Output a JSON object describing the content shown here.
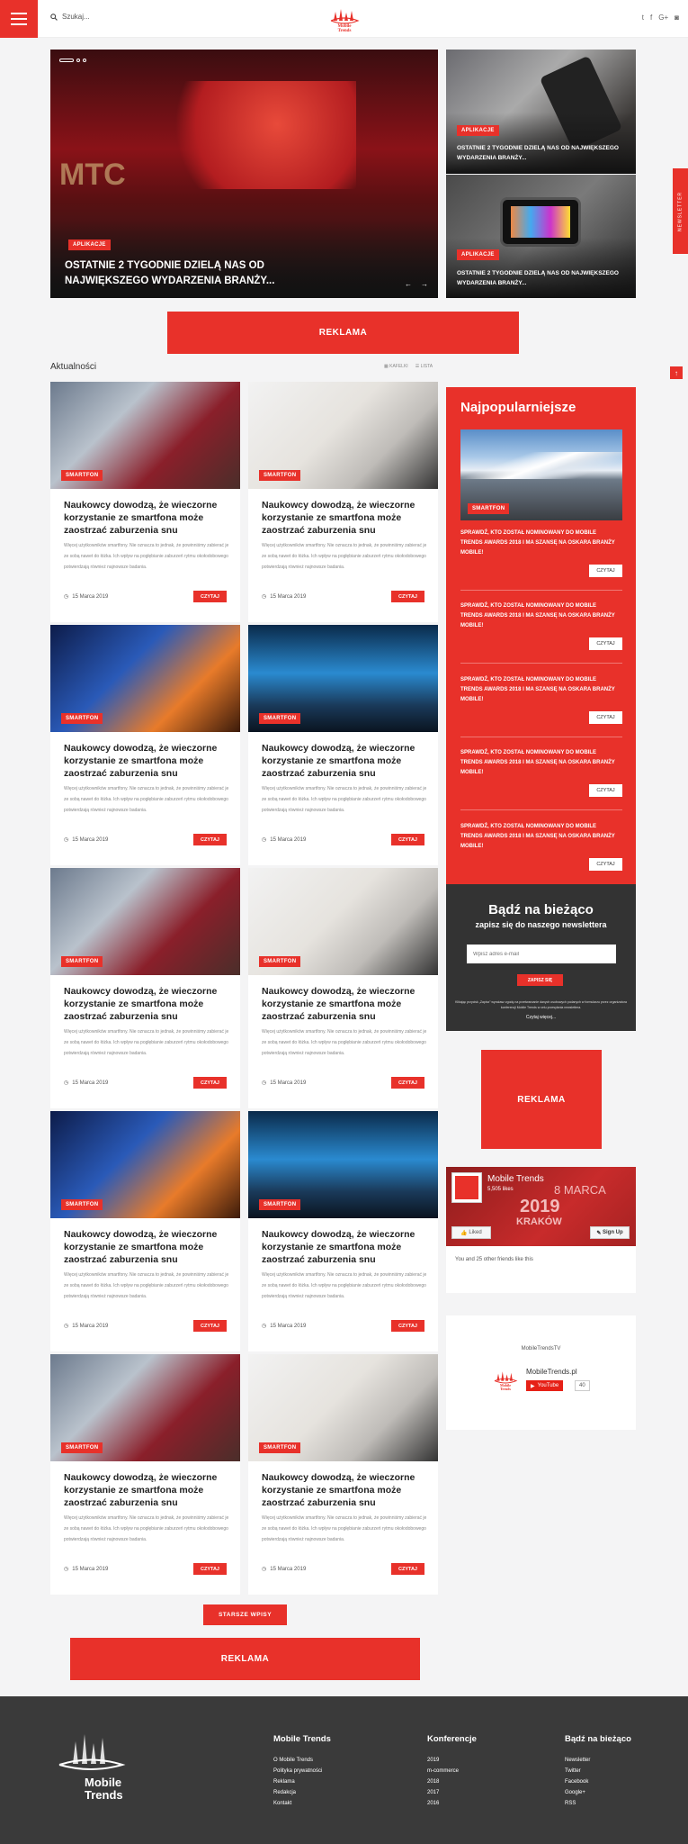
{
  "header": {
    "search_label": "Szukaj..."
  },
  "hero": {
    "main": {
      "tag": "APLIKACJE",
      "title": "OSTATNIE 2 TYGODNIE DZIELĄ NAS OD NAJWIĘKSZEGO WYDARZENIA BRANŻY...",
      "prev": "←",
      "next": "→"
    },
    "side1": {
      "tag": "APLIKACJE",
      "title": "OSTATNIE 2 TYGODNIE DZIELĄ NAS OD NAJWIĘKSZEGO WYDARZENIA BRANŻY..."
    },
    "side2": {
      "tag": "APLIKACJE",
      "title": "OSTATNIE 2 TYGODNIE DZIELĄ NAS OD NAJWIĘKSZEGO WYDARZENIA BRANŻY..."
    }
  },
  "ads": {
    "top": "REKLAMA",
    "side": "REKLAMA",
    "bottom": "REKLAMA"
  },
  "news_section": {
    "title": "Aktualności",
    "view_tiles": "KAFELKI",
    "view_list": "LISTA",
    "older_button": "STARSZE WPISY"
  },
  "cards": [
    {
      "tag": "SMARTFON",
      "title": "Naukowcy dowodzą, że wieczorne korzystanie ze smartfona może zaostrzać zaburzenia snu",
      "text": "Więcej użytkowników smartfony. Nie oznacza to jednak, że powinniśmy zabierać je ze sobą nawet do łóżka. Ich wpływ na pogłębianie zaburzeń rytmu okołodobowego potwierdzają również najnowsze badania.",
      "date": "15 Marca 2019",
      "button": "CZYTAJ"
    },
    {
      "tag": "SMARTFON",
      "title": "Naukowcy dowodzą, że wieczorne korzystanie ze smartfona może zaostrzać zaburzenia snu",
      "text": "Więcej użytkowników smartfony. Nie oznacza to jednak, że powinniśmy zabierać je ze sobą nawet do łóżka. Ich wpływ na pogłębianie zaburzeń rytmu okołodobowego potwierdzają również najnowsze badania.",
      "date": "15 Marca 2019",
      "button": "CZYTAJ"
    },
    {
      "tag": "SMARTFON",
      "title": "Naukowcy dowodzą, że wieczorne korzystanie ze smartfona może zaostrzać zaburzenia snu",
      "text": "Więcej użytkowników smartfony. Nie oznacza to jednak, że powinniśmy zabierać je ze sobą nawet do łóżka. Ich wpływ na pogłębianie zaburzeń rytmu okołodobowego potwierdzają również najnowsze badania.",
      "date": "15 Marca 2019",
      "button": "CZYTAJ"
    },
    {
      "tag": "SMARTFON",
      "title": "Naukowcy dowodzą, że wieczorne korzystanie ze smartfona może zaostrzać zaburzenia snu",
      "text": "Więcej użytkowników smartfony. Nie oznacza to jednak, że powinniśmy zabierać je ze sobą nawet do łóżka. Ich wpływ na pogłębianie zaburzeń rytmu okołodobowego potwierdzają również najnowsze badania.",
      "date": "15 Marca 2019",
      "button": "CZYTAJ"
    },
    {
      "tag": "SMARTFON",
      "title": "Naukowcy dowodzą, że wieczorne korzystanie ze smartfona może zaostrzać zaburzenia snu",
      "text": "Więcej użytkowników smartfony. Nie oznacza to jednak, że powinniśmy zabierać je ze sobą nawet do łóżka. Ich wpływ na pogłębianie zaburzeń rytmu okołodobowego potwierdzają również najnowsze badania.",
      "date": "15 Marca 2019",
      "button": "CZYTAJ"
    },
    {
      "tag": "SMARTFON",
      "title": "Naukowcy dowodzą, że wieczorne korzystanie ze smartfona może zaostrzać zaburzenia snu",
      "text": "Więcej użytkowników smartfony. Nie oznacza to jednak, że powinniśmy zabierać je ze sobą nawet do łóżka. Ich wpływ na pogłębianie zaburzeń rytmu okołodobowego potwierdzają również najnowsze badania.",
      "date": "15 Marca 2019",
      "button": "CZYTAJ"
    },
    {
      "tag": "SMARTFON",
      "title": "Naukowcy dowodzą, że wieczorne korzystanie ze smartfona może zaostrzać zaburzenia snu",
      "text": "Więcej użytkowników smartfony. Nie oznacza to jednak, że powinniśmy zabierać je ze sobą nawet do łóżka. Ich wpływ na pogłębianie zaburzeń rytmu okołodobowego potwierdzają również najnowsze badania.",
      "date": "15 Marca 2019",
      "button": "CZYTAJ"
    },
    {
      "tag": "SMARTFON",
      "title": "Naukowcy dowodzą, że wieczorne korzystanie ze smartfona może zaostrzać zaburzenia snu",
      "text": "Więcej użytkowników smartfony. Nie oznacza to jednak, że powinniśmy zabierać je ze sobą nawet do łóżka. Ich wpływ na pogłębianie zaburzeń rytmu okołodobowego potwierdzają również najnowsze badania.",
      "date": "15 Marca 2019",
      "button": "CZYTAJ"
    },
    {
      "tag": "SMARTFON",
      "title": "Naukowcy dowodzą, że wieczorne korzystanie ze smartfona może zaostrzać zaburzenia snu",
      "text": "Więcej użytkowników smartfony. Nie oznacza to jednak, że powinniśmy zabierać je ze sobą nawet do łóżka. Ich wpływ na pogłębianie zaburzeń rytmu okołodobowego potwierdzają również najnowsze badania.",
      "date": "15 Marca 2019",
      "button": "CZYTAJ"
    },
    {
      "tag": "SMARTFON",
      "title": "Naukowcy dowodzą, że wieczorne korzystanie ze smartfona może zaostrzać zaburzenia snu",
      "text": "Więcej użytkowników smartfony. Nie oznacza to jednak, że powinniśmy zabierać je ze sobą nawet do łóżka. Ich wpływ na pogłębianie zaburzeń rytmu okołodobowego potwierdzają również najnowsze badania.",
      "date": "15 Marca 2019",
      "button": "CZYTAJ"
    }
  ],
  "popular": {
    "title": "Najpopularniejsze",
    "img_tag": "SMARTFON",
    "items": [
      {
        "text": "SPRAWDŹ, KTO ZOSTAŁ NOMINOWANY DO MOBILE TRENDS AWARDS 2018 I MA SZANSĘ NA OSKARA BRANŻY MOBILE!",
        "button": "CZYTAJ"
      },
      {
        "text": "SPRAWDŹ, KTO ZOSTAŁ NOMINOWANY DO MOBILE TRENDS AWARDS 2018 I MA SZANSĘ NA OSKARA BRANŻY MOBILE!",
        "button": "CZYTAJ"
      },
      {
        "text": "SPRAWDŹ, KTO ZOSTAŁ NOMINOWANY DO MOBILE TRENDS AWARDS 2018 I MA SZANSĘ NA OSKARA BRANŻY MOBILE!",
        "button": "CZYTAJ"
      },
      {
        "text": "SPRAWDŹ, KTO ZOSTAŁ NOMINOWANY DO MOBILE TRENDS AWARDS 2018 I MA SZANSĘ NA OSKARA BRANŻY MOBILE!",
        "button": "CZYTAJ"
      },
      {
        "text": "SPRAWDŹ, KTO ZOSTAŁ NOMINOWANY DO MOBILE TRENDS AWARDS 2018 I MA SZANSĘ NA OSKARA BRANŻY MOBILE!",
        "button": "CZYTAJ"
      }
    ]
  },
  "newsletter": {
    "title": "Bądź na bieżąco",
    "subtitle": "zapisz się do naszego newslettera",
    "placeholder": "Wpisz adres e-mail",
    "button": "ZAPISZ SIĘ",
    "fine_print": "Klikając przycisk „Zapisz” wyrażasz zgodę na przetwarzanie danych osobowych podanych w formularzu przez organizatora konferencji Mobile Trends w celu przesyłania newslettera.",
    "more": "Czytaj więcej..."
  },
  "facebook": {
    "page_name": "Mobile Trends",
    "likes": "5,505 likes",
    "date": "8 MARCA",
    "year": "2019",
    "city": "KRAKÓW",
    "liked": "Liked",
    "signup": "Sign Up",
    "friends": "You and 25 other friends like this"
  },
  "youtube": {
    "title": "MobileTrendsTV",
    "channel": "MobileTrends.pl",
    "button": "YouTube",
    "count": "40"
  },
  "logo": {
    "line1": "Mobile",
    "line2": "Trends"
  },
  "footer": {
    "col1": {
      "title": "Mobile Trends",
      "links": [
        "O Mobile Trends",
        "Polityka prywatności",
        "Reklama",
        "Redakcja",
        "Kontakt"
      ]
    },
    "col2": {
      "title": "Konferencje",
      "links": [
        "2019",
        "m-commerce",
        "2018",
        "2017",
        "2016"
      ]
    },
    "col3": {
      "title": "Bądź na bieżąco",
      "links": [
        "Newsletter",
        "Twitter",
        "Facebook",
        "Google+",
        "RSS"
      ]
    }
  },
  "side_tab": {
    "label": "NEWSLETTER"
  },
  "colors": {
    "accent": "#e8312a",
    "dark": "#3a3a3a"
  }
}
